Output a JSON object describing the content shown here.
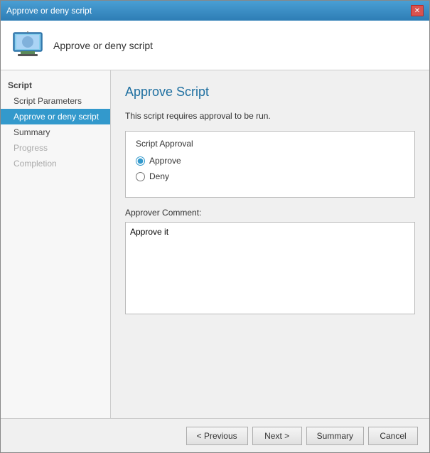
{
  "window": {
    "title": "Approve or deny script",
    "close_label": "✕"
  },
  "header": {
    "icon_label": "computer-icon",
    "text": "Approve or deny script"
  },
  "sidebar": {
    "section_label": "Script",
    "items": [
      {
        "label": "Script Parameters",
        "state": "normal",
        "id": "script-parameters"
      },
      {
        "label": "Approve or deny script",
        "state": "active",
        "id": "approve-deny"
      },
      {
        "label": "Summary",
        "state": "normal",
        "id": "summary"
      },
      {
        "label": "Progress",
        "state": "disabled",
        "id": "progress"
      },
      {
        "label": "Completion",
        "state": "disabled",
        "id": "completion"
      }
    ]
  },
  "main": {
    "page_title": "Approve Script",
    "description": "This script requires approval to be run.",
    "group_box_label": "Script Approval",
    "radio_options": [
      {
        "label": "Approve",
        "value": "approve",
        "checked": true
      },
      {
        "label": "Deny",
        "value": "deny",
        "checked": false
      }
    ],
    "comment_label": "Approver Comment:",
    "comment_value": "Approve it"
  },
  "footer": {
    "previous_label": "< Previous",
    "next_label": "Next >",
    "summary_label": "Summary",
    "cancel_label": "Cancel"
  }
}
